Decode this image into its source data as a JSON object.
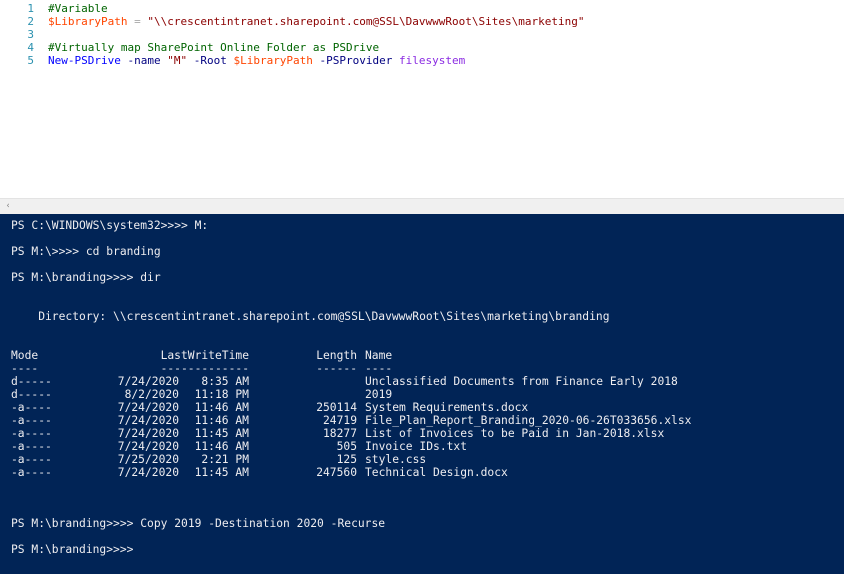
{
  "editor": {
    "lines": [
      {
        "num": "1",
        "tokens": [
          {
            "text": "#Variable",
            "kind": "comment"
          }
        ]
      },
      {
        "num": "2",
        "tokens": [
          {
            "text": "$LibraryPath",
            "kind": "variable"
          },
          {
            "text": " = ",
            "kind": "operator"
          },
          {
            "text": "\"\\\\crescentintranet.sharepoint.com@SSL\\DavwwwRoot\\Sites\\marketing\"",
            "kind": "string"
          }
        ]
      },
      {
        "num": "3",
        "tokens": []
      },
      {
        "num": "4",
        "tokens": [
          {
            "text": "#Virtually map SharePoint Online Folder as PSDrive",
            "kind": "comment"
          }
        ]
      },
      {
        "num": "5",
        "tokens": [
          {
            "text": "New-PSDrive",
            "kind": "command"
          },
          {
            "text": " -name ",
            "kind": "param"
          },
          {
            "text": "\"M\"",
            "kind": "string"
          },
          {
            "text": " -Root ",
            "kind": "param"
          },
          {
            "text": "$LibraryPath",
            "kind": "variable"
          },
          {
            "text": " -PSProvider ",
            "kind": "param"
          },
          {
            "text": "filesystem",
            "kind": "arg"
          }
        ]
      }
    ]
  },
  "splitter": {
    "scroll_left_glyph": "‹"
  },
  "console": {
    "prompts": [
      "PS C:\\WINDOWS\\system32>>>> M:",
      "PS M:\\>>>> cd branding",
      "PS M:\\branding>>>> dir"
    ],
    "directory_line": "    Directory: \\\\crescentintranet.sharepoint.com@SSL\\DavwwwRoot\\Sites\\marketing\\branding",
    "table": {
      "headers": {
        "mode": "Mode",
        "lastwrite": "LastWriteTime",
        "length": "Length",
        "name": "Name"
      },
      "underlines": {
        "mode": "----",
        "lastwrite": "-------------",
        "length": "------",
        "name": "----"
      },
      "rows": [
        {
          "mode": "d-----",
          "date": "7/24/2020",
          "time": "8:35 AM",
          "length": "",
          "name": "Unclassified Documents from Finance Early 2018"
        },
        {
          "mode": "d-----",
          "date": "8/2/2020",
          "time": "11:18 PM",
          "length": "",
          "name": "2019"
        },
        {
          "mode": "-a----",
          "date": "7/24/2020",
          "time": "11:46 AM",
          "length": "250114",
          "name": "System Requirements.docx"
        },
        {
          "mode": "-a----",
          "date": "7/24/2020",
          "time": "11:46 AM",
          "length": "24719",
          "name": "File_Plan_Report_Branding_2020-06-26T033656.xlsx"
        },
        {
          "mode": "-a----",
          "date": "7/24/2020",
          "time": "11:45 AM",
          "length": "18277",
          "name": "List of Invoices to be Paid in Jan-2018.xlsx"
        },
        {
          "mode": "-a----",
          "date": "7/24/2020",
          "time": "11:46 AM",
          "length": "505",
          "name": "Invoice IDs.txt"
        },
        {
          "mode": "-a----",
          "date": "7/25/2020",
          "time": "2:21 PM",
          "length": "125",
          "name": "style.css"
        },
        {
          "mode": "-a----",
          "date": "7/24/2020",
          "time": "11:45 AM",
          "length": "247560",
          "name": "Technical Design.docx"
        }
      ]
    },
    "after_prompts": [
      "PS M:\\branding>>>> Copy 2019 -Destination 2020 -Recurse",
      "PS M:\\branding>>>>"
    ]
  },
  "colors": {
    "console_bg": "#012456",
    "console_fg": "#eeedf0",
    "comment": "#006400",
    "variable": "#ff4500",
    "string": "#8b0000",
    "command": "#0000ff",
    "param": "#000080",
    "argument": "#8a2be2",
    "line_number": "#2b91af"
  }
}
